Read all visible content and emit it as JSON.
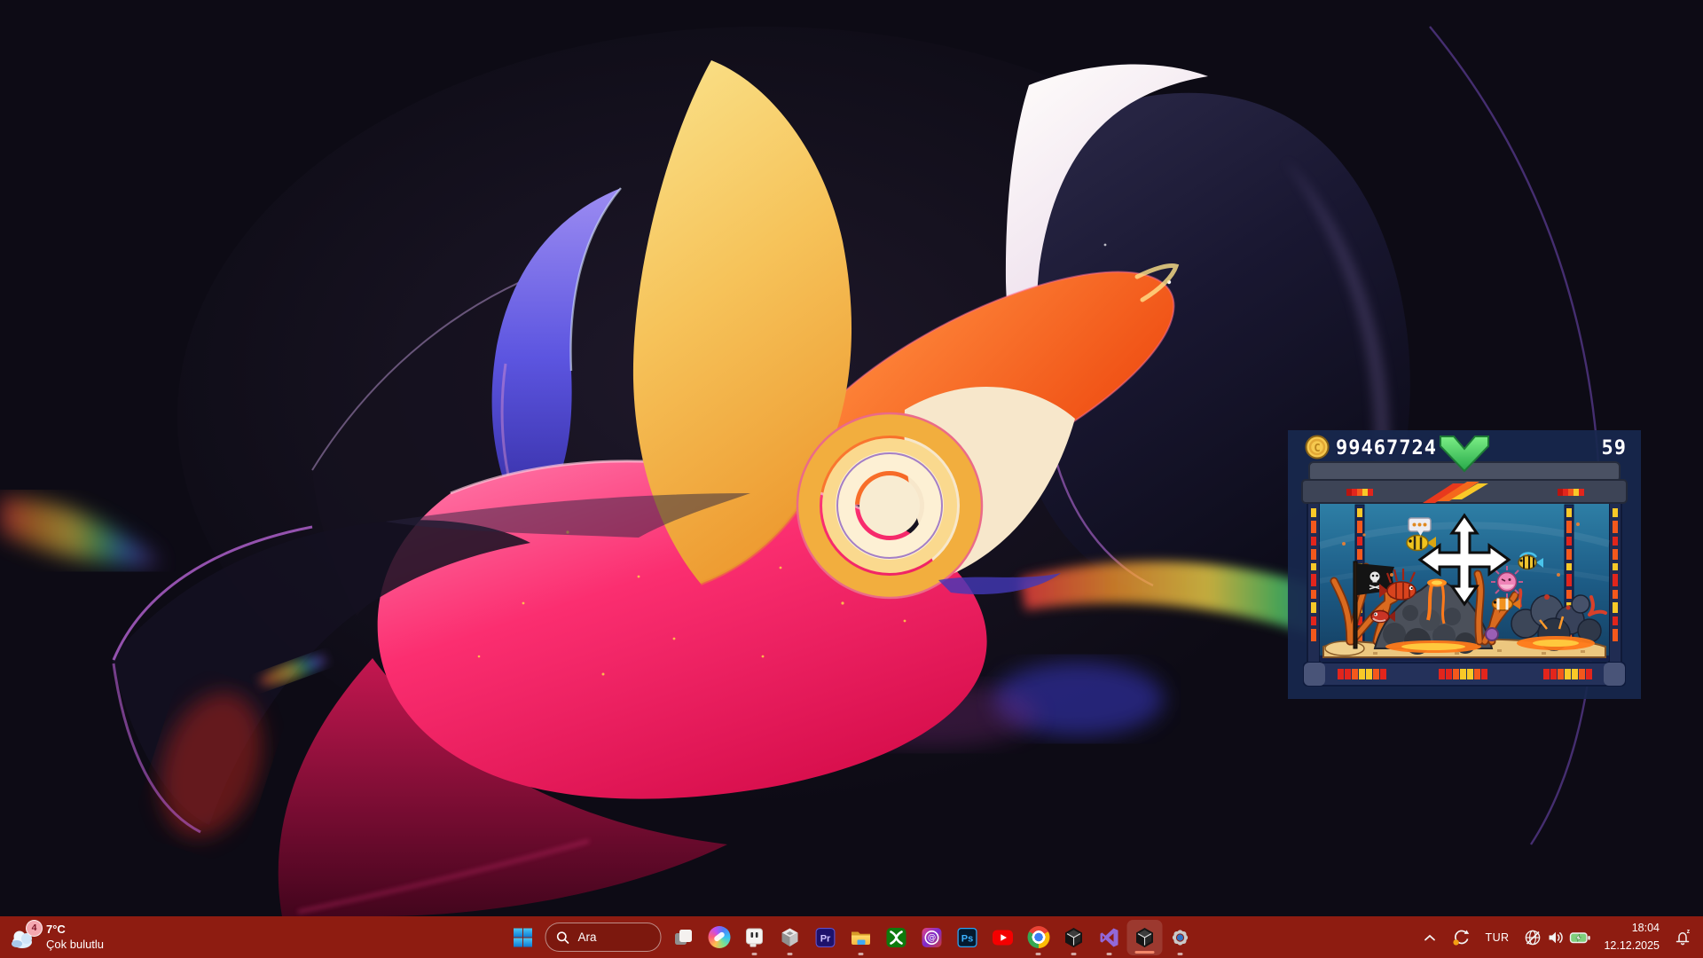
{
  "wallpaper": {
    "background": "#0d0b15",
    "accent_colors": {
      "pink": "#fb2e70",
      "yellow": "#f6c35a",
      "orange": "#ee4a10",
      "blue": "#5c55e0",
      "silver": "#efe2ee"
    }
  },
  "widget": {
    "coin_count": "99467724",
    "counter": "59",
    "coin_gold": "#f6c94f",
    "accent_green": "#3fcf5c",
    "fish": [
      "yellow-tang",
      "lionfish",
      "pufferfish",
      "angelfish",
      "clownfish",
      "piranha"
    ],
    "decor": [
      "lamp-bar",
      "volcano",
      "corals",
      "pirate-flag",
      "lava-rocks",
      "sand"
    ]
  },
  "taskbar": {
    "background": "#8e1c11",
    "weather": {
      "badge": "4",
      "temperature": "7°C",
      "condition": "Çok bulutlu"
    },
    "search": {
      "label": "Ara"
    },
    "apps": [
      {
        "icon": "task-view-icon"
      },
      {
        "icon": "copilot-icon"
      },
      {
        "icon": "plug-app-icon",
        "running": true
      },
      {
        "icon": "unity-hub-icon",
        "running": true
      },
      {
        "icon": "premiere-pro-icon"
      },
      {
        "icon": "file-explorer-icon",
        "running": true
      },
      {
        "icon": "xbox-icon"
      },
      {
        "icon": "at-symbol-app-icon"
      },
      {
        "icon": "photoshop-icon"
      },
      {
        "icon": "youtube-icon"
      },
      {
        "icon": "chrome-icon",
        "running": true
      },
      {
        "icon": "unity-editor-icon",
        "running": true
      },
      {
        "icon": "visual-studio-icon",
        "running": true
      },
      {
        "icon": "unity-editor-icon",
        "running": true,
        "active": true
      },
      {
        "icon": "settings-icon",
        "running": true
      }
    ],
    "tray": {
      "language": "TUR",
      "time": "18:04",
      "date": "12.12.2025"
    }
  }
}
